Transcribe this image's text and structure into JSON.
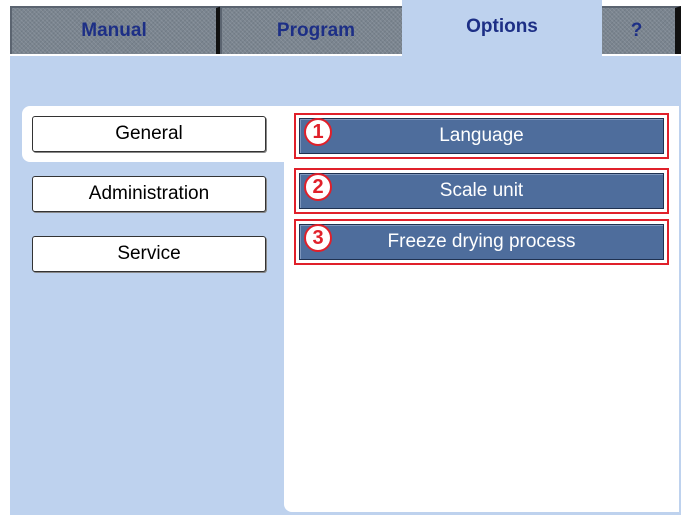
{
  "tabs": [
    {
      "label": "Manual"
    },
    {
      "label": "Program"
    },
    {
      "label": "Options"
    },
    {
      "label": "?"
    }
  ],
  "active_tab": "Options",
  "sidebar": {
    "items": [
      {
        "label": "General"
      },
      {
        "label": "Administration"
      },
      {
        "label": "Service"
      }
    ],
    "selected": "General"
  },
  "options": [
    {
      "number": "1",
      "label": "Language"
    },
    {
      "number": "2",
      "label": "Scale unit"
    },
    {
      "number": "3",
      "label": "Freeze drying process"
    }
  ],
  "colors": {
    "background_panel": "#bed2ee",
    "tab_inactive": "#7b8590",
    "tab_text": "#1d2f86",
    "option_button": "#4e6d9c",
    "annotation_red": "#e0202a"
  }
}
